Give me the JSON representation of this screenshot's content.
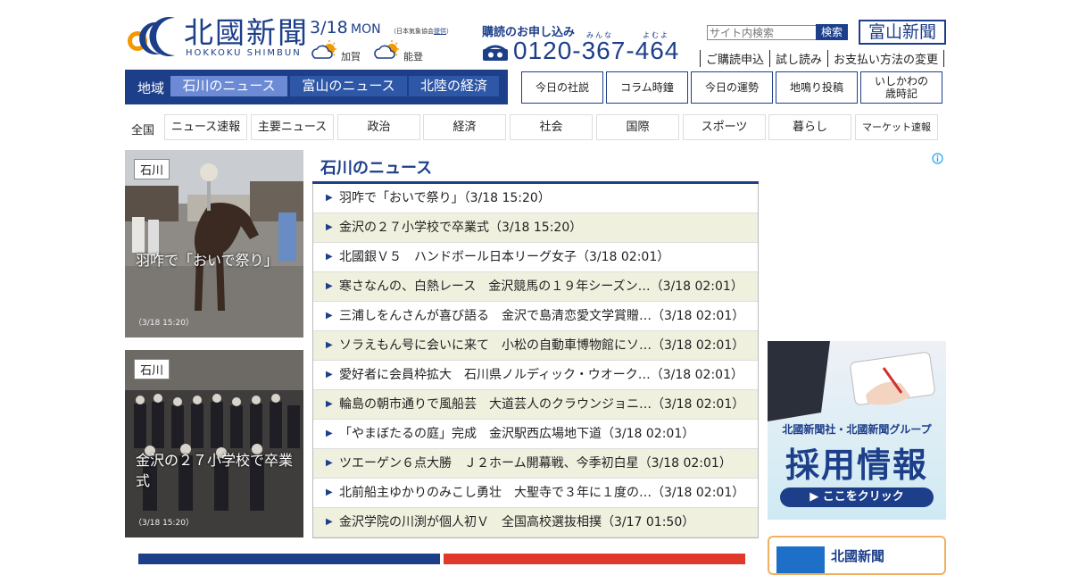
{
  "header": {
    "logo_ja": "北國新聞",
    "logo_en": "HOKKOKU SHIMBUN",
    "date": "3/18",
    "day": "MON",
    "weather_source_prefix": "（日本気象協会",
    "weather_source_link": "提供",
    "weather_source_suffix": "）",
    "weather": [
      {
        "region": "加賀",
        "icon": "cloud-sun-icon"
      },
      {
        "region": "能登",
        "icon": "cloud-sun-icon"
      }
    ],
    "subscribe_title": "購読のお申し込み",
    "phone_ruby_1": "みんな",
    "phone_ruby_2": "よむよ",
    "phone": "0120-367-464",
    "search_placeholder": "サイト内検索",
    "search_button": "検索",
    "toyama_button": "富山新聞",
    "links": [
      "ご購読申込",
      "試し読み",
      "お支払い方法の変更"
    ]
  },
  "region_nav": {
    "label": "地域",
    "tabs": [
      "石川のニュース",
      "富山のニュース",
      "北陸の経済"
    ]
  },
  "quick_links": [
    "今日の社説",
    "コラム時鐘",
    "今日の運勢",
    "地鳴り投稿",
    "いしかわの",
    "歳時記"
  ],
  "categories": {
    "label": "全国",
    "items": [
      "ニュース速報",
      "主要ニュース",
      "政治",
      "経済",
      "社会",
      "国際",
      "スポーツ",
      "暮らし",
      "マーケット速報"
    ]
  },
  "featured": [
    {
      "tag": "石川",
      "caption": "羽咋で「おいで祭り」",
      "time": "（3/18 15:20）"
    },
    {
      "tag": "石川",
      "caption": "金沢の２７小学校で卒業式",
      "time": "（3/18 15:20）"
    }
  ],
  "news": {
    "title": "石川のニュース",
    "items": [
      "羽咋で「おいで祭り」（3/18 15:20）",
      "金沢の２７小学校で卒業式（3/18 15:20）",
      "北國銀Ｖ５　ハンドボール日本リーグ女子（3/18 02:01）",
      "寒さなんの、白熱レース　金沢競馬の１９年シーズン…（3/18 02:01）",
      "三浦しをんさんが喜び語る　金沢で島清恋愛文学賞贈…（3/18 02:01）",
      "ソラえもん号に会いに来て　小松の自動車博物館にソ…（3/18 02:01）",
      "愛好者に会員枠拡大　石川県ノルディック・ウオーク…（3/18 02:01）",
      "輪島の朝市通りで風船芸　大道芸人のクラウンジョニ…（3/18 02:01）",
      "「やまぼたるの庭」完成　金沢駅西広場地下道（3/18 02:01）",
      "ツエーゲン６点大勝　Ｊ２ホーム開幕戦、今季初白星（3/18 02:01）",
      "北前船主ゆかりのみこし勇壮　大聖寺で３年に１度の…（3/18 02:01）",
      "金沢学院の川渕が個人初Ｖ　全国高校選抜相撲（3/17 01:50）"
    ]
  },
  "recruit": {
    "line1": "北國新聞社・北國新聞グループ",
    "line2": "採用情報",
    "button": "▶ ここをクリック"
  },
  "app_box": {
    "title": "北國新聞"
  },
  "colors": {
    "brand": "#1d3f8a",
    "active_tab": "#6d8ad4",
    "stripe": "#f0f0df"
  }
}
